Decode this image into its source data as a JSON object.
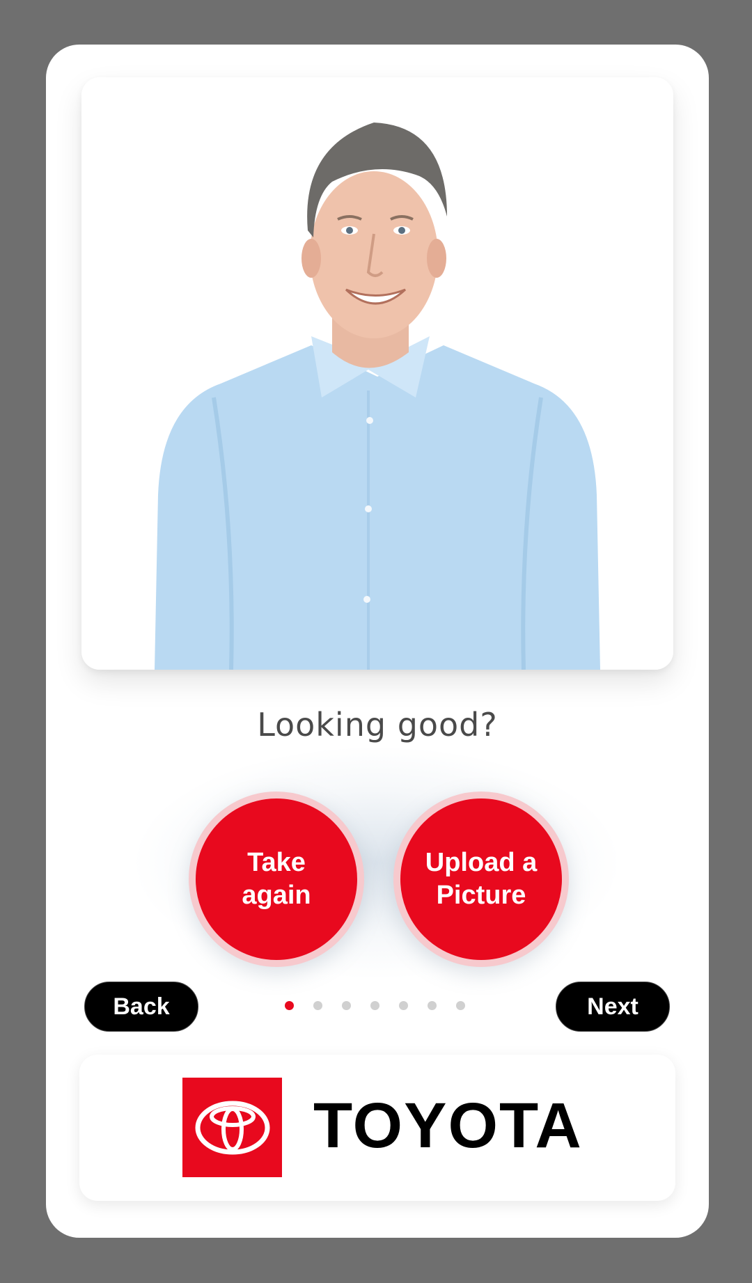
{
  "screen": {
    "question": "Looking good?"
  },
  "actions": {
    "take_again_label": "Take again",
    "upload_label": "Upload a Picture"
  },
  "navigation": {
    "back_label": "Back",
    "next_label": "Next",
    "step_current": 1,
    "step_total": 7
  },
  "brand": {
    "name": "TOYOTA",
    "accent_color": "#e8091e"
  },
  "icons": {
    "logo": "toyota-emblem-icon"
  }
}
